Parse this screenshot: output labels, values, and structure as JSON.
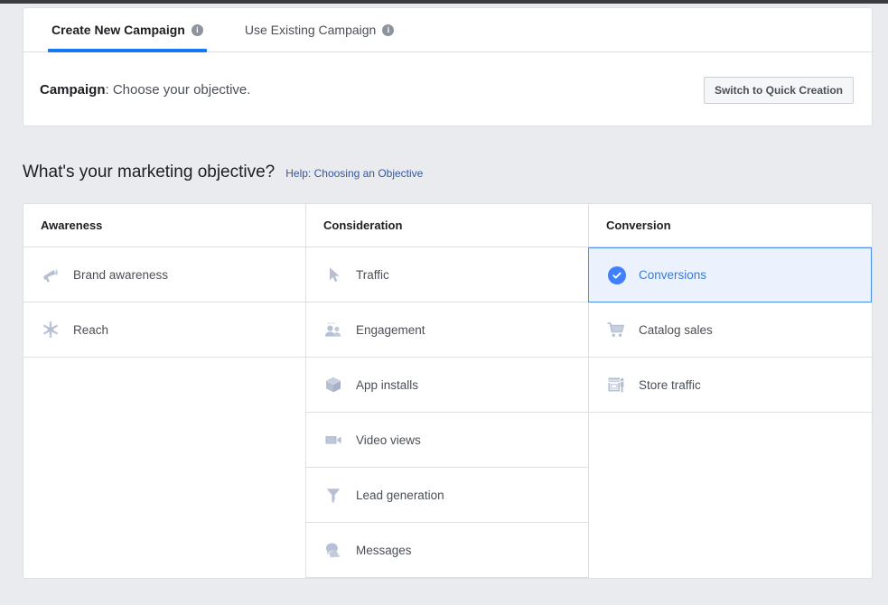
{
  "colors": {
    "accent": "#1877f2",
    "selected_bg": "#ebf2fd",
    "selected_border": "#4a90e8",
    "selected_text": "#3a7bd5",
    "page_bg": "#e9ebee",
    "icon_gray": "#b7c0d3",
    "link": "#365899"
  },
  "tabs": [
    {
      "label": "Create New Campaign",
      "info_icon": "info-icon",
      "active": true
    },
    {
      "label": "Use Existing Campaign",
      "info_icon": "info-icon",
      "active": false
    }
  ],
  "campaign_bar": {
    "label_bold": "Campaign",
    "label_rest": ": Choose your objective.",
    "button_label": "Switch to Quick Creation"
  },
  "objective_section": {
    "heading": "What's your marketing objective?",
    "help_link": "Help: Choosing an Objective"
  },
  "columns": [
    {
      "header": "Awareness",
      "items": [
        {
          "label": "Brand awareness",
          "icon": "megaphone-icon",
          "selected": false
        },
        {
          "label": "Reach",
          "icon": "reach-starburst-icon",
          "selected": false
        }
      ]
    },
    {
      "header": "Consideration",
      "items": [
        {
          "label": "Traffic",
          "icon": "cursor-arrow-icon",
          "selected": false
        },
        {
          "label": "Engagement",
          "icon": "people-icon",
          "selected": false
        },
        {
          "label": "App installs",
          "icon": "cube-box-icon",
          "selected": false
        },
        {
          "label": "Video views",
          "icon": "video-camera-icon",
          "selected": false
        },
        {
          "label": "Lead generation",
          "icon": "funnel-icon",
          "selected": false
        },
        {
          "label": "Messages",
          "icon": "speech-bubbles-icon",
          "selected": false
        }
      ]
    },
    {
      "header": "Conversion",
      "items": [
        {
          "label": "Conversions",
          "icon": "check-circle-icon",
          "selected": true
        },
        {
          "label": "Catalog sales",
          "icon": "shopping-cart-icon",
          "selected": false
        },
        {
          "label": "Store traffic",
          "icon": "storefront-icon",
          "selected": false
        }
      ]
    }
  ]
}
